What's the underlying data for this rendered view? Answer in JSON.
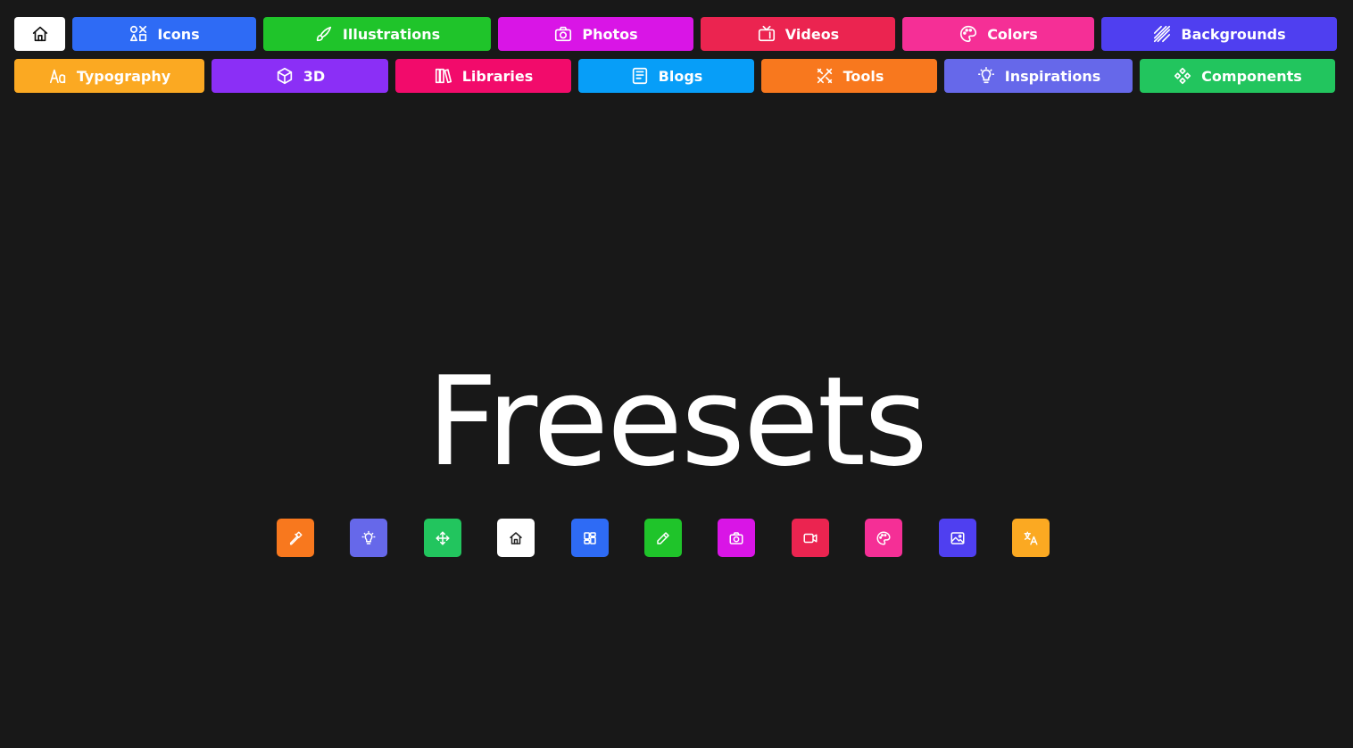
{
  "nav": {
    "row1": [
      {
        "label": "",
        "icon": "home-icon",
        "color": "#ffffff"
      },
      {
        "label": "Icons",
        "icon": "shapes-icon",
        "color": "#2e6bf5"
      },
      {
        "label": "Illustrations",
        "icon": "brush-icon",
        "color": "#1fc42a"
      },
      {
        "label": "Photos",
        "icon": "camera-icon",
        "color": "#d915e6"
      },
      {
        "label": "Videos",
        "icon": "tv-icon",
        "color": "#eb2450"
      },
      {
        "label": "Colors",
        "icon": "palette-icon",
        "color": "#f52f96"
      },
      {
        "label": "Backgrounds",
        "icon": "stripes-icon",
        "color": "#4f3ff0"
      }
    ],
    "row2": [
      {
        "label": "Typography",
        "icon": "typography-icon",
        "color": "#fba922"
      },
      {
        "label": "3D",
        "icon": "cube-icon",
        "color": "#8b2ff6"
      },
      {
        "label": "Libraries",
        "icon": "books-icon",
        "color": "#f20b6b"
      },
      {
        "label": "Blogs",
        "icon": "news-icon",
        "color": "#079ef8"
      },
      {
        "label": "Tools",
        "icon": "tools-icon",
        "color": "#f8781e"
      },
      {
        "label": "Inspirations",
        "icon": "bulb-icon",
        "color": "#6668ea"
      },
      {
        "label": "Components",
        "icon": "components-icon",
        "color": "#22c55e"
      }
    ]
  },
  "hero": {
    "title": "Freesets"
  },
  "tiles": [
    {
      "icon": "hammer-icon",
      "color": "#f8781e"
    },
    {
      "icon": "bulb-icon",
      "color": "#6668ea"
    },
    {
      "icon": "move-icon",
      "color": "#22c55e"
    },
    {
      "icon": "home-icon",
      "color": "#ffffff"
    },
    {
      "icon": "dashboard-icon",
      "color": "#2e6bf5"
    },
    {
      "icon": "pencil-icon",
      "color": "#1fc42a"
    },
    {
      "icon": "camera-icon",
      "color": "#d915e6"
    },
    {
      "icon": "video-icon",
      "color": "#eb2450"
    },
    {
      "icon": "palette-icon",
      "color": "#f52f96"
    },
    {
      "icon": "image-icon",
      "color": "#4f3ff0"
    },
    {
      "icon": "translate-icon",
      "color": "#fba922"
    }
  ]
}
